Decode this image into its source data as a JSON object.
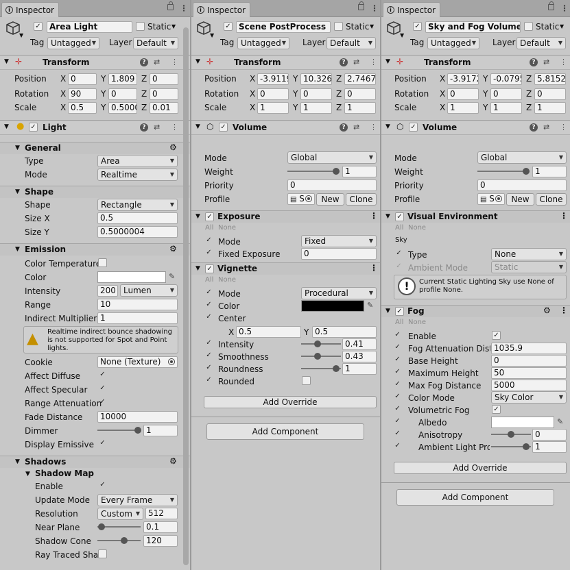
{
  "tab_label": "Inspector",
  "common": {
    "tag_label": "Tag",
    "tag_value": "Untagged",
    "layer_label": "Layer",
    "layer_value": "Default",
    "static_label": "Static",
    "transform_title": "Transform",
    "position_label": "Position",
    "rotation_label": "Rotation",
    "scale_label": "Scale",
    "x": "X",
    "y": "Y",
    "z": "Z",
    "all": "All",
    "none": "None",
    "add_component": "Add Component",
    "add_override": "Add Override",
    "volume_title": "Volume",
    "mode_label": "Mode",
    "weight_label": "Weight",
    "priority_label": "Priority",
    "profile_label": "Profile",
    "global": "Global",
    "weight_value": "1",
    "priority_value": "0",
    "profile_value": "S",
    "new": "New",
    "clone": "Clone"
  },
  "p1": {
    "name": "Area Light",
    "position": [
      "0",
      "1.809",
      "0"
    ],
    "rotation": [
      "90",
      "0",
      "0"
    ],
    "scale": [
      "0.5",
      "0.5000",
      "0.01"
    ],
    "light_title": "Light",
    "general": "General",
    "type_label": "Type",
    "type_value": "Area",
    "mode_label": "Mode",
    "mode_value": "Realtime",
    "shape_section": "Shape",
    "shape_label": "Shape",
    "shape_value": "Rectangle",
    "sizex_label": "Size X",
    "sizex_value": "0.5",
    "sizey_label": "Size Y",
    "sizey_value": "0.5000004",
    "emission": "Emission",
    "color_temp": "Color Temperature",
    "color_label": "Color",
    "intensity_label": "Intensity",
    "intensity_value": "200",
    "intensity_unit": "Lumen",
    "range_label": "Range",
    "range_value": "10",
    "indirect_label": "Indirect Multiplier",
    "indirect_value": "1",
    "warning": "Realtime indirect bounce shadowing is not supported for Spot and Point lights.",
    "cookie_label": "Cookie",
    "cookie_value": "None (Texture)",
    "affect_diffuse": "Affect Diffuse",
    "affect_specular": "Affect Specular",
    "range_atten": "Range Attenuation",
    "fade_label": "Fade Distance",
    "fade_value": "10000",
    "dimmer_label": "Dimmer",
    "dimmer_value": "1",
    "display_emissive": "Display Emissive M",
    "shadows": "Shadows",
    "shadow_map": "Shadow Map",
    "enable_label": "Enable",
    "update_label": "Update Mode",
    "update_value": "Every Frame",
    "resolution_label": "Resolution",
    "resolution_drop": "Custom",
    "resolution_value": "512",
    "near_label": "Near Plane",
    "near_value": "0.1",
    "cone_label": "Shadow Cone",
    "cone_value": "120",
    "raytraced_label": "Ray Traced Sha"
  },
  "p2": {
    "name": "Scene PostProcess",
    "position": [
      "-3.9119",
      "10.326",
      "2.74671"
    ],
    "rotation": [
      "0",
      "0",
      "0"
    ],
    "scale": [
      "1",
      "1",
      "1"
    ],
    "exposure": "Exposure",
    "exp_mode_label": "Mode",
    "exp_mode_value": "Fixed",
    "fixed_exp_label": "Fixed Exposure",
    "fixed_exp_value": "0",
    "vignette": "Vignette",
    "vig_mode_label": "Mode",
    "vig_mode_value": "Procedural",
    "vig_color_label": "Color",
    "center_label": "Center",
    "center_x": "0.5",
    "center_y": "0.5",
    "intensity_label": "Intensity",
    "intensity_value": "0.41",
    "smooth_label": "Smoothness",
    "smooth_value": "0.43",
    "round_label": "Roundness",
    "round_value": "1",
    "rounded_label": "Rounded"
  },
  "p3": {
    "name": "Sky and Fog Volume",
    "position": [
      "-3.9172",
      "-0.0795",
      "5.81527"
    ],
    "rotation": [
      "0",
      "0",
      "0"
    ],
    "scale": [
      "1",
      "1",
      "1"
    ],
    "visual_env": "Visual Environment",
    "sky": "Sky",
    "type_label": "Type",
    "type_value": "None",
    "ambient_label": "Ambient Mode",
    "ambient_value": "Static",
    "info": "Current Static Lighting Sky use None of profile None.",
    "fog": "Fog",
    "enable_label": "Enable",
    "atten_label": "Fog Attenuation Dista",
    "atten_value": "1035.9",
    "base_label": "Base Height",
    "base_value": "0",
    "max_h_label": "Maximum Height",
    "max_h_value": "50",
    "max_d_label": "Max Fog Distance",
    "max_d_value": "5000",
    "color_mode_label": "Color Mode",
    "color_mode_value": "Sky Color",
    "volumetric_label": "Volumetric Fog",
    "albedo_label": "Albedo",
    "aniso_label": "Anisotropy",
    "aniso_value": "0",
    "ambient_probe_label": "Ambient Light Prob",
    "ambient_probe_value": "1"
  }
}
